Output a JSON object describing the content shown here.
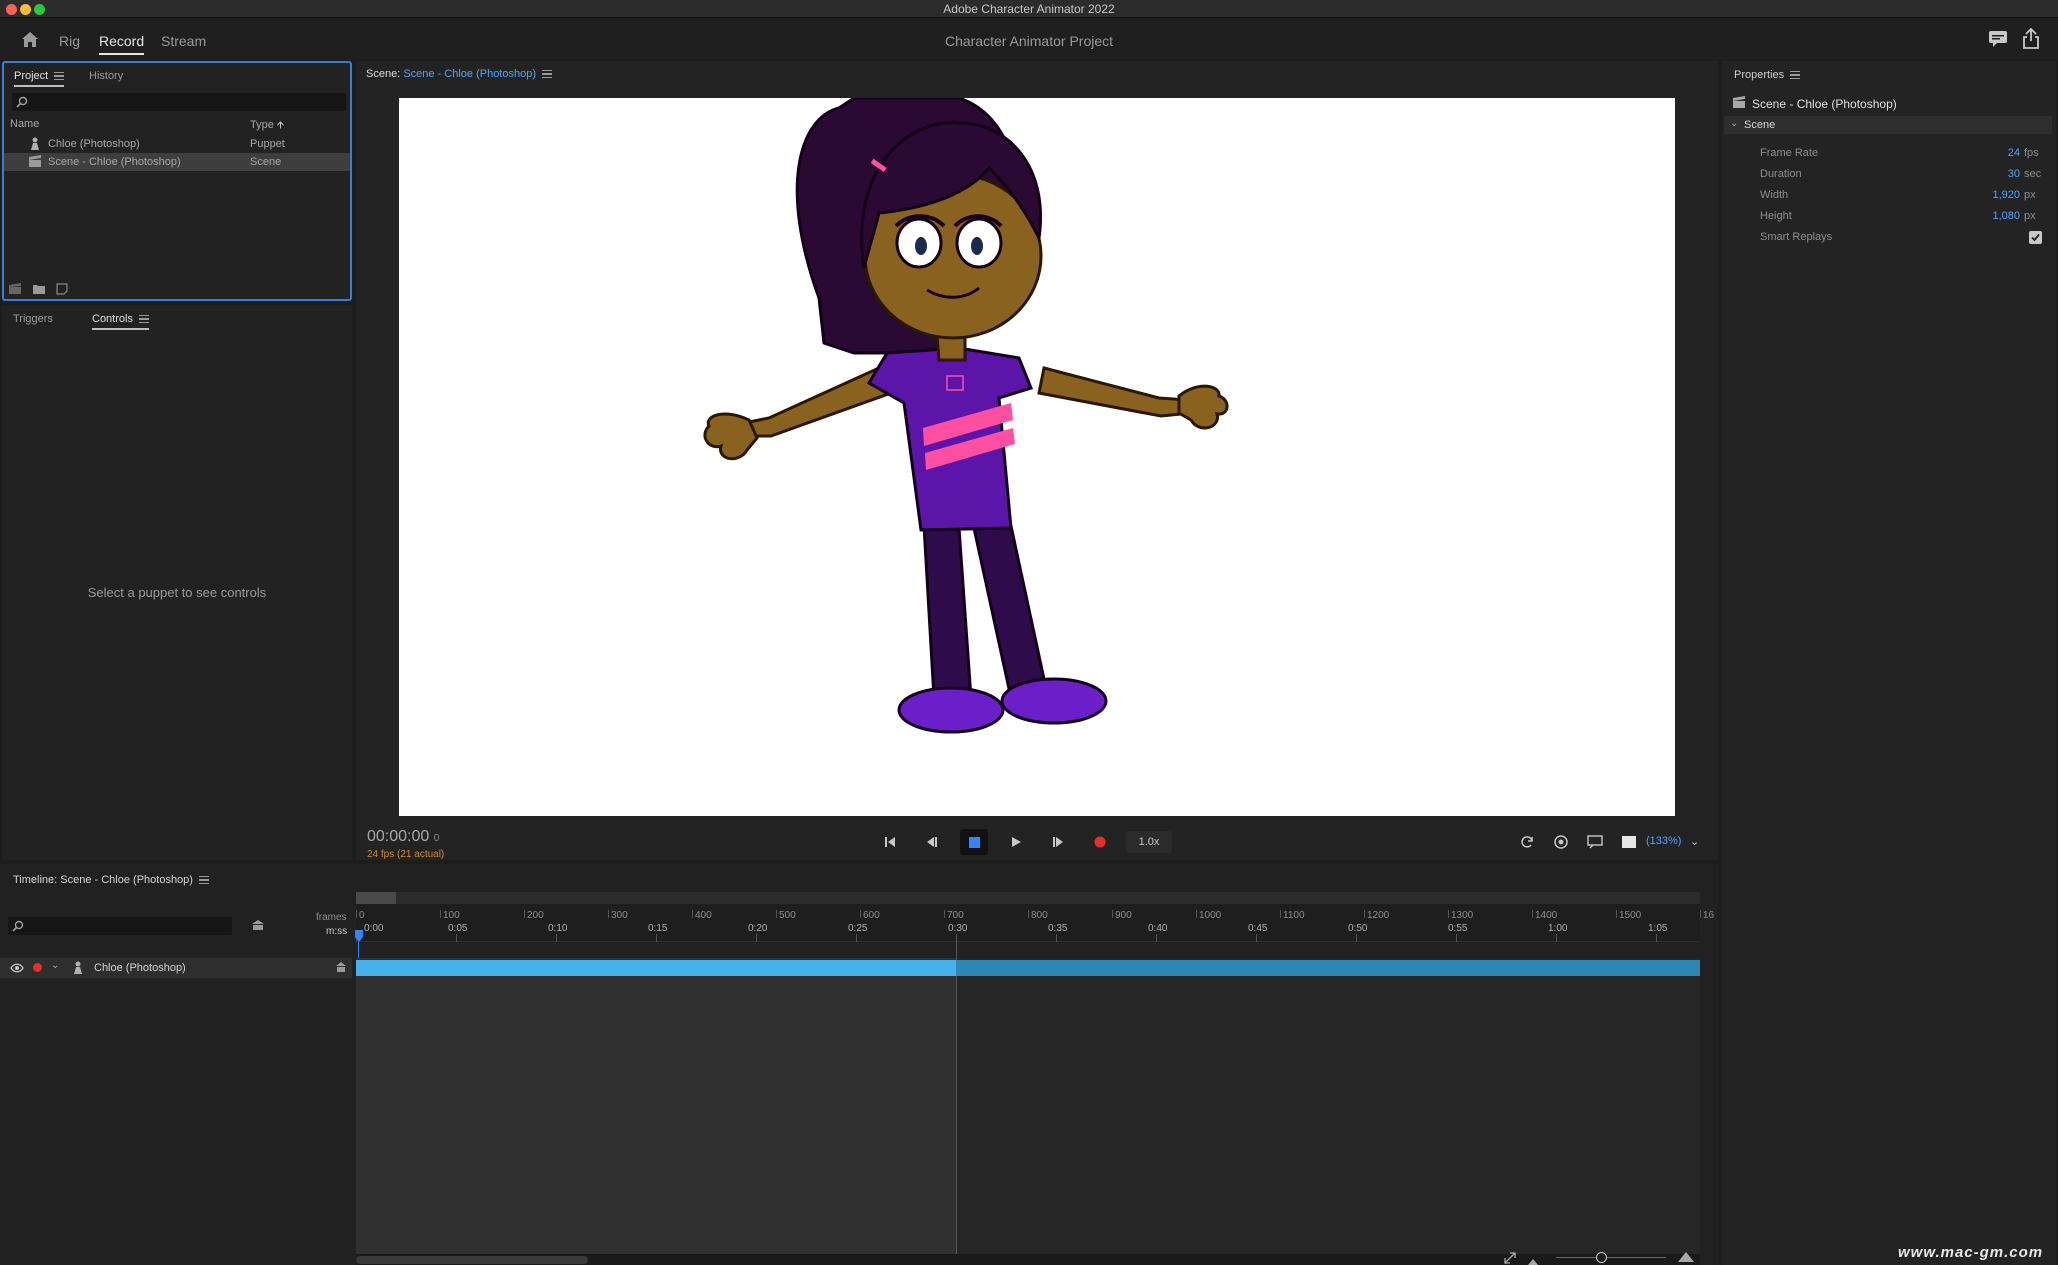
{
  "window": {
    "title": "Adobe Character Animator 2022",
    "traffic_colors": [
      "#fe5f57",
      "#febc2e",
      "#28c840"
    ]
  },
  "header": {
    "tabs": [
      "Rig",
      "Record",
      "Stream"
    ],
    "active_tab": "Record",
    "project_title": "Character Animator Project",
    "home_icon": "home-icon",
    "right_icons": [
      "comment-icon",
      "share-icon"
    ]
  },
  "project_panel": {
    "tabs": [
      "Project",
      "History"
    ],
    "active_tab": "Project",
    "search_placeholder": "",
    "columns": [
      "Name",
      "Type"
    ],
    "rows": [
      {
        "name": "Chloe (Photoshop)",
        "type": "Puppet",
        "icon": "puppet-icon",
        "selected": false
      },
      {
        "name": "Scene - Chloe (Photoshop)",
        "type": "Scene",
        "icon": "scene-clapper-icon",
        "selected": true
      }
    ],
    "footer_icons": [
      "new-scene-icon",
      "folder-icon",
      "new-item-icon"
    ]
  },
  "controls_panel": {
    "tabs": [
      "Triggers",
      "Controls"
    ],
    "active_tab": "Controls",
    "empty_message": "Select a puppet to see controls"
  },
  "scene_panel": {
    "label": "Scene:",
    "scene_name": "Scene - Chloe (Photoshop)",
    "timecode": "00:00:00",
    "frame": "0",
    "fps_status": "24 fps (21 actual)",
    "speed": "1.0x",
    "zoom": "(133%)",
    "transport_icons": [
      "go-to-start-icon",
      "step-back-icon",
      "stop-icon",
      "play-icon",
      "step-forward-icon",
      "record-icon"
    ],
    "right_icons": [
      "refresh-icon",
      "camera-icon",
      "stream-display-icon",
      "background-swatch-icon"
    ]
  },
  "properties_panel": {
    "title": "Properties",
    "object_name": "Scene - Chloe (Photoshop)",
    "section": "Scene",
    "fields": [
      {
        "label": "Frame Rate",
        "value": "24",
        "unit": "fps"
      },
      {
        "label": "Duration",
        "value": "30",
        "unit": "sec"
      },
      {
        "label": "Width",
        "value": "1,920",
        "unit": "px"
      },
      {
        "label": "Height",
        "value": "1,080",
        "unit": "px"
      }
    ],
    "smart_replays": {
      "label": "Smart Replays",
      "checked": true
    }
  },
  "timeline_panel": {
    "title": "Timeline: Scene - Chloe (Photoshop)",
    "row_labels": [
      "frames",
      "m:ss"
    ],
    "frame_ticks": [
      "0",
      "100",
      "200",
      "300",
      "400",
      "500",
      "600",
      "700",
      "800",
      "900",
      "1000",
      "1100",
      "1200",
      "1300",
      "1400",
      "1500",
      "16"
    ],
    "time_ticks": [
      "0:00",
      "0:05",
      "0:10",
      "0:15",
      "0:20",
      "0:25",
      "0:30",
      "0:35",
      "0:40",
      "0:45",
      "0:50",
      "0:55",
      "1:00",
      "1:05"
    ],
    "track": {
      "name": "Chloe (Photoshop)"
    }
  },
  "watermark": "www.mac-gm.com",
  "colors": {
    "accent_blue": "#4ea3ff",
    "selection_border": "#3a7dd6",
    "track_bar": "#45b3ea",
    "record_red": "#e5302a",
    "fps_orange": "#d08a2e"
  }
}
